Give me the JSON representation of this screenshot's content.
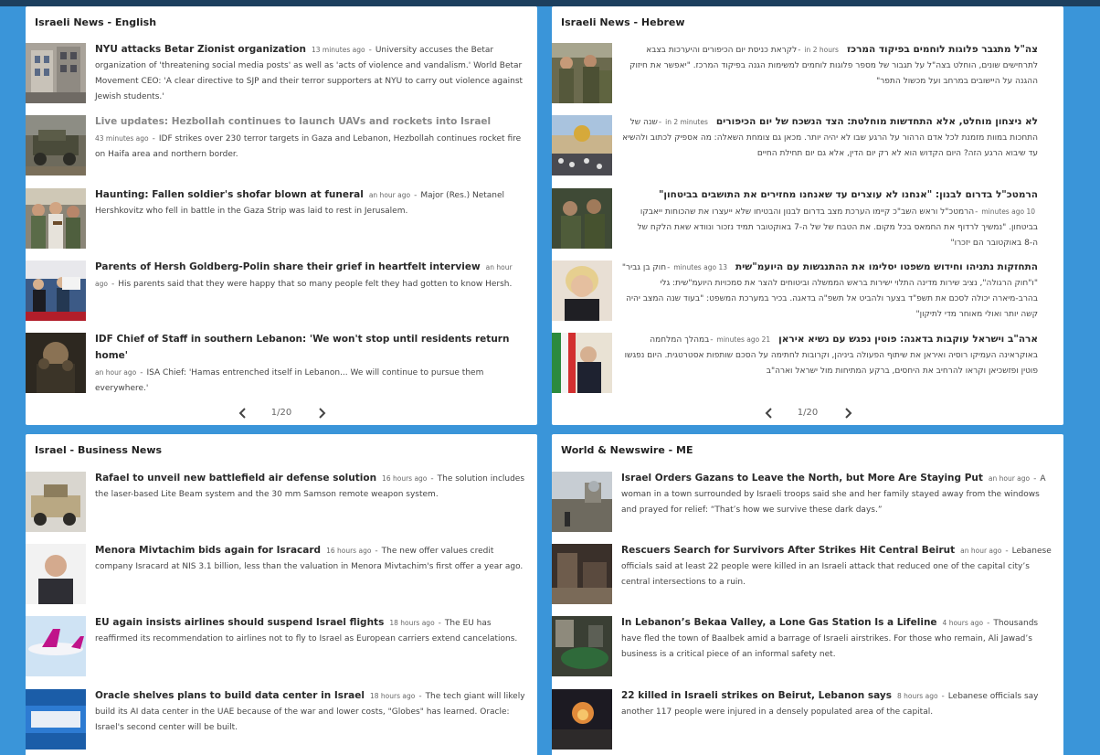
{
  "panels": {
    "english": {
      "title": "Israeli News - English",
      "pager": "1/20",
      "items": [
        {
          "headline": "NYU attacks Betar Zionist organization",
          "time": "13 minutes ago",
          "summary": "University accuses the Betar organization of 'threatening social media posts' as well as 'acts of violence and vandalism.' World Betar Movement CEO: 'A clear directive to SJP and their terror supporters at NYU to carry out violence against Jewish students.'"
        },
        {
          "headline": "Live updates: Hezbollah continues to launch UAVs and rockets into Israel",
          "time": "43 minutes ago",
          "summary": "IDF strikes over 230 terror targets in Gaza and Lebanon, Hezbollah continues rocket fire on Haifa area and northern border."
        },
        {
          "headline": "Haunting: Fallen soldier's shofar blown at funeral",
          "time": "an hour ago",
          "summary": "Major (Res.) Netanel Hershkovitz who fell in battle in the Gaza Strip was laid to rest in Jerusalem."
        },
        {
          "headline": "Parents of Hersh Goldberg-Polin share their grief in heartfelt interview",
          "time": "an hour ago",
          "summary": "His parents said that they were happy that so many people felt they had gotten to know Hersh."
        },
        {
          "headline": "IDF Chief of Staff in southern Lebanon: 'We won't stop until residents return home'",
          "time": "an hour ago",
          "summary": "ISA Chief: 'Hamas entrenched itself in Lebanon... We will continue to pursue them everywhere.'"
        }
      ]
    },
    "hebrew": {
      "title": "Israeli News - Hebrew",
      "pager": "1/20",
      "items": [
        {
          "headline": "צה\"ל מתגבר פלוגות לוחמים בפיקוד המרכז",
          "time": "in 2 hours",
          "summary": "לקראת כניסת יום הכיפורים והיערכות בצבא לתרחישים שונים, הוחלט בצה\"ל על תגבור של מספר פלוגות לוחמים למשימות הגנה בפיקוד המרכז. \"יאפשר את חיזוק ההגנה על היישובים במרחב ועל מכשול התפר\""
        },
        {
          "headline": "לא ניצחון מוחלט, אלא התחדשות מוחלטת: הצד הנשכח של יום הכיפורים",
          "time": "in 2 minutes",
          "summary": "שנה של התחכות במוות מזמנת לכל אדם הרהור על הרגע שבו לא יהיה יותר. מכאן גם צומחת השאלה: מה אספיק לכתוב ולהשיא עד שיבוא הרגע הזה? היום הקדוש הוא לא רק יום הדין, אלא גם יום תחילת החיים"
        },
        {
          "headline": "הרמטכ\"ל בדרום לבנון: \"אנחנו לא עוצרים עד שאנחנו מחזירים את התושבים בביטחון\"",
          "time": "10 minutes ago",
          "summary": "הרמטכ\"ל וראש השב\"כ קיימו הערכת מצב בדרום לבנון והבטיחו שלא ייעצרו את שהכוחות ייאבקו בביטחון. \"נמשיך לרדוף את החמאס בכל מקום. את הטבח של של ה-7 באוקטובר תמיד נזכור ונוודא שאת הלקח של ה-8 באוקטובר הם יזכרו\""
        },
        {
          "headline": "התחזקות נתניהו וחידוש משפטו יסלימו את ההתנגשות עם היועמ\"שית",
          "time": "13 minutes ago",
          "summary": "חוק בן גביר\" \"ו\"חוק הרגולה\", נציב שירות מדינה התלוי ישירות בראש הממשלה וביטוחים להצר את סמכויות היועמ\"שית: גלי בהרב-מיארה יכולה לסכם את תשפ\"ד בצער ולהביט אל תשפ\"ה בדאגה. בכיר במערכת המשפט: \"בעוד שנה המצב יהיה קשה יותר ואולי מאוחר מדי לתיקון\""
        },
        {
          "headline": "ארה\"ב וישראל עוקבות בדאגה: פוטין נפגש עם נשיא איראן",
          "time": "21 minutes ago",
          "summary": "במהלך המלחמה באוקראינה העמיקו רוסיה ואיראן את שיתוף הפעולה ביניהן, וקרובות לחתימה על הסכם שותפות אסטרטגית. היום נפגשו פוטין ופזשכיאן וקראו להרחיב את היחסים, ברקע המתיחות מול ישראל וארה\"ב"
        }
      ]
    },
    "business": {
      "title": "Israel - Business News",
      "items": [
        {
          "headline": "Rafael to unveil new battlefield air defense solution",
          "time": "16 hours ago",
          "summary": "The solution includes the laser-based Lite Beam system and the 30 mm Samson remote weapon system."
        },
        {
          "headline": "Menora Mivtachim bids again for Isracard",
          "time": "16 hours ago",
          "summary": "The new offer values credit company Isracard at NIS 3.1 billion, less than the valuation in Menora Mivtachim's first offer a year ago."
        },
        {
          "headline": "EU again insists airlines should suspend Israel flights",
          "time": "18 hours ago",
          "summary": "The EU has reaffirmed its recommendation to airlines not to fly to Israel as European carriers extend cancelations."
        },
        {
          "headline": "Oracle shelves plans to build data center in Israel",
          "time": "18 hours ago",
          "summary": "The tech giant will likely build its AI data center in the UAE because of the war and lower costs, \"Globes\" has learned. Oracle: Israel's second center will be built."
        }
      ]
    },
    "world": {
      "title": "World & Newswire - ME",
      "items": [
        {
          "headline": "Israel Orders Gazans to Leave the North, but More Are Staying Put",
          "time": "an hour ago",
          "summary": "A woman in a town surrounded by Israeli troops said she and her family stayed away from the windows and prayed for relief: “That’s how we survive these dark days.”"
        },
        {
          "headline": "Rescuers Search for Survivors After Strikes Hit Central Beirut",
          "time": "an hour ago",
          "summary": "Lebanese officials said at least 22 people were killed in an Israeli attack that reduced one of the capital city’s central intersections to a ruin."
        },
        {
          "headline": "In Lebanon’s Bekaa Valley, a Lone Gas Station Is a Lifeline",
          "time": "4 hours ago",
          "summary": "Thousands have fled the town of Baalbek amid a barrage of Israeli airstrikes. For those who remain, Ali Jawad’s business is a critical piece of an informal safety net."
        },
        {
          "headline": "22 killed in Israeli strikes on Beirut, Lebanon says",
          "time": "8 hours ago",
          "summary": "Lebanese officials say another 117 people were injured in a densely populated area of the capital."
        }
      ]
    }
  }
}
